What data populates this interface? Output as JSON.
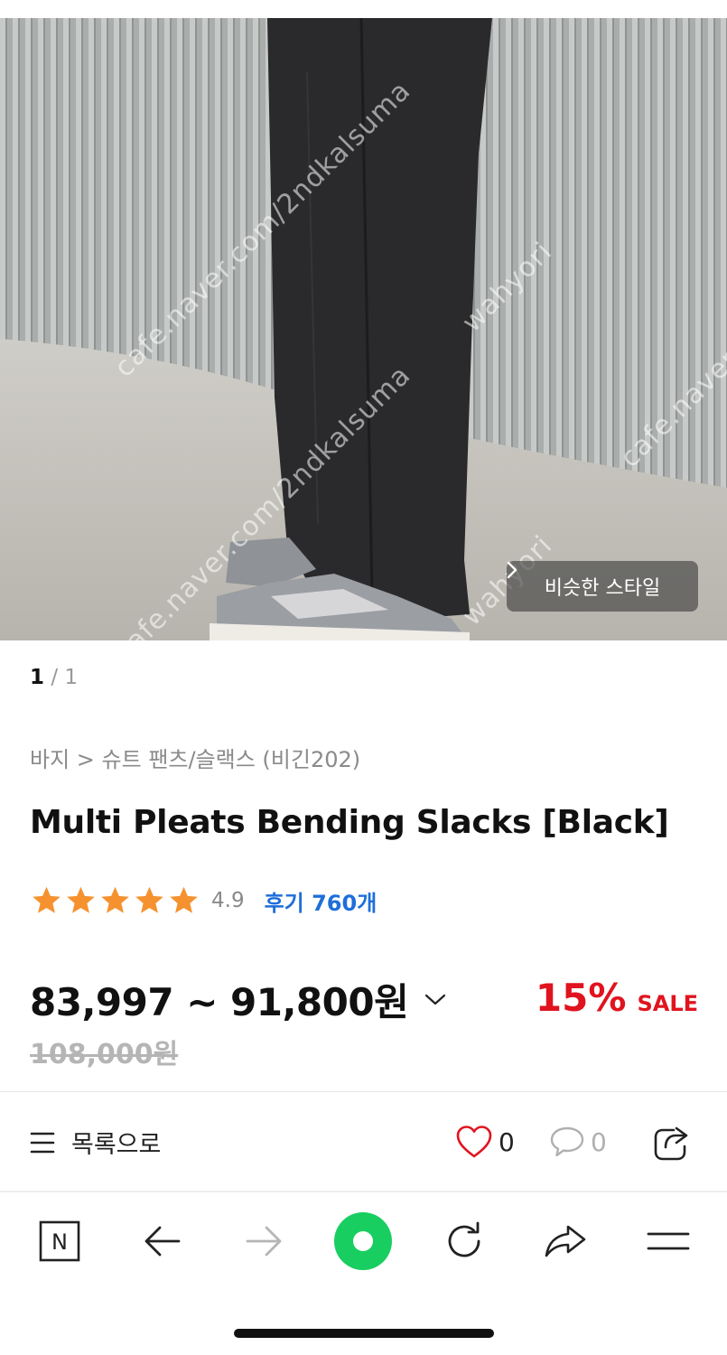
{
  "photo": {
    "watermarks": [
      "cafe.naver.com/2ndkalsuma",
      "wahyori",
      "cafe.naver.com/2ndkalsuma",
      "wahyori",
      "cafe.naver.c"
    ],
    "similar_style_label": "비슷한 스타일"
  },
  "pager": {
    "current": "1",
    "separator": " / ",
    "total": "1"
  },
  "product": {
    "breadcrumb": "바지 > 슈트 팬츠/슬랙스 (비긴202)",
    "title": "Multi Pleats Bending Slacks [Black]",
    "rating": 4.9,
    "rating_text": "4.9",
    "review_label": "후기 760개",
    "price_range": "83,997 ~ 91,800원",
    "original_price": "108,000원",
    "discount_percent": "15%",
    "sale_label": "SALE"
  },
  "actions": {
    "list_label": "목록으로",
    "like_count": "0",
    "comment_count": "0"
  },
  "toolbar": {
    "home_label": "N"
  },
  "colors": {
    "accent_blue": "#1e6fd9",
    "sale_red": "#e0141e",
    "star_orange": "#f5922f",
    "naver_green": "#19ce60"
  }
}
